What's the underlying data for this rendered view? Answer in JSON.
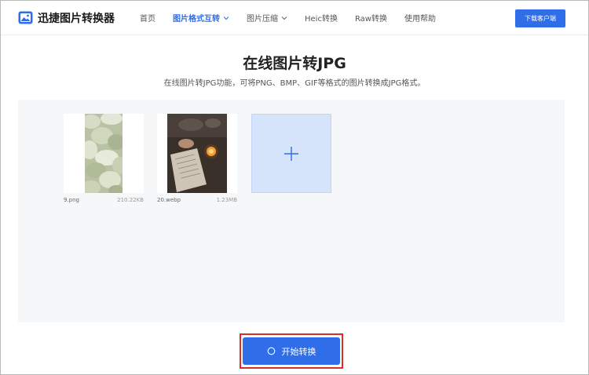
{
  "header": {
    "brand": "迅捷图片转换器",
    "nav": [
      {
        "label": "首页",
        "active": false,
        "dropdown": false
      },
      {
        "label": "图片格式互转",
        "active": true,
        "dropdown": true
      },
      {
        "label": "图片压缩",
        "active": false,
        "dropdown": true
      },
      {
        "label": "Heic转换",
        "active": false,
        "dropdown": false
      },
      {
        "label": "Raw转换",
        "active": false,
        "dropdown": false
      },
      {
        "label": "使用帮助",
        "active": false,
        "dropdown": false
      }
    ],
    "download_label": "下载客户端"
  },
  "main": {
    "title": "在线图片转JPG",
    "subtitle": "在线图片转JPG功能，可将PNG、BMP、GIF等格式的图片转换成JPG格式。",
    "files": [
      {
        "name": "9.png",
        "size": "210.22KB"
      },
      {
        "name": "20.webp",
        "size": "1.23MB"
      }
    ],
    "add_icon": "plus-icon",
    "start_label": "开始转换"
  },
  "colors": {
    "accent": "#2f6ee8",
    "highlight": "#e02b2b",
    "panel_bg": "#f6f7f9",
    "add_tile_bg": "#d5e3fb"
  }
}
